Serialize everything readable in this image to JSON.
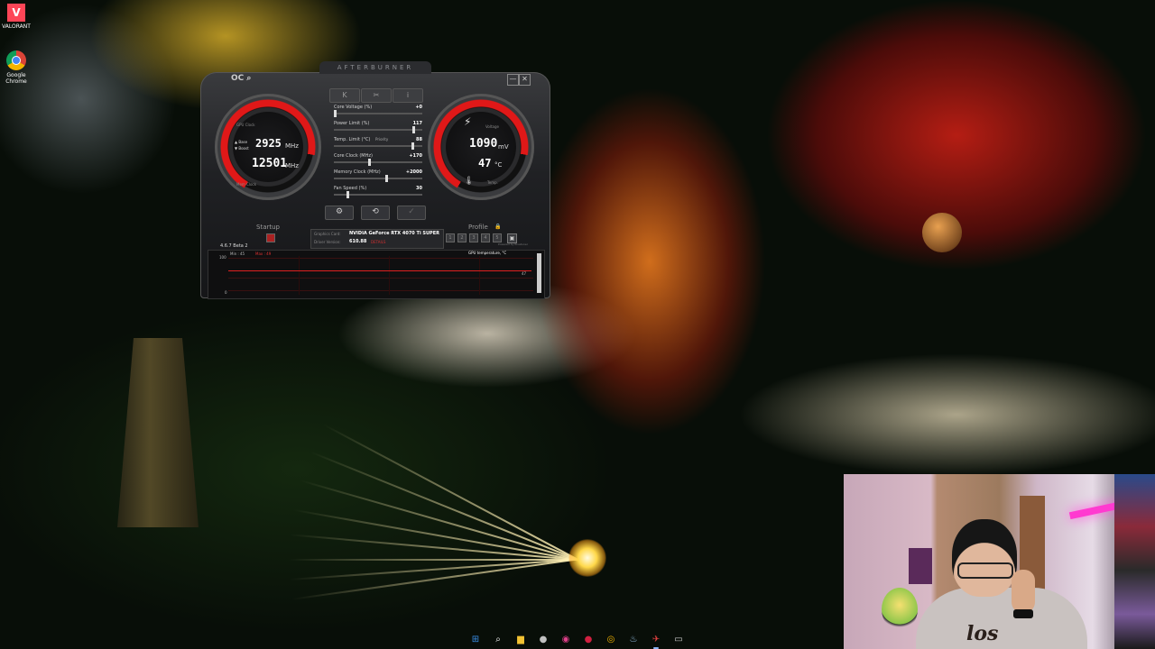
{
  "desktop": {
    "icons": [
      {
        "label": "VALORANT",
        "glyph": "V"
      },
      {
        "label": "Google Chrome"
      }
    ]
  },
  "afterburner": {
    "brand": "AFTERBURNER",
    "oc_label": "OC",
    "window_buttons": {
      "minimize": "—",
      "close": "✕"
    },
    "top_buttons": [
      "K",
      "✂",
      "i"
    ],
    "left_gauge": {
      "label_top": "GPU Clock",
      "label_bottom": "Mem Clock",
      "base_label": "▲ Base",
      "boost_label": "▼ Boost",
      "gpu_clock": "2925",
      "gpu_clock_unit": "MHz",
      "mem_clock": "12501",
      "mem_clock_unit": "MHz",
      "ticks": [
        "250",
        "500",
        "750",
        "1000",
        "1250",
        "1500",
        "1750",
        "2000",
        "2250",
        "2500",
        "3000",
        "3750",
        "4500",
        "5250"
      ]
    },
    "right_gauge": {
      "label_top": "Voltage",
      "label_bottom": "Temp.",
      "voltage": "1090",
      "voltage_unit": "mV",
      "temp": "47",
      "temp_unit": "°C",
      "ticks": [
        "0.75",
        "1",
        "1.25",
        "1.5",
        "1.75",
        "32°F",
        "50",
        "68",
        "86",
        "104",
        "122",
        "140",
        "158",
        "176",
        "194"
      ]
    },
    "sliders": [
      {
        "label": "Core Voltage (%)",
        "value": "+0",
        "fill": 0.0
      },
      {
        "label": "Power Limit (%)",
        "value": "117",
        "fill": 0.92
      },
      {
        "label": "Temp. Limit (°C)",
        "sub": "Priority",
        "value": "88",
        "fill": 0.9
      },
      {
        "label": "Core Clock (MHz)",
        "value": "+170",
        "fill": 0.4
      },
      {
        "label": "Memory Clock (MHz)",
        "value": "+2000",
        "fill": 0.6
      },
      {
        "label": "Fan Speed (%)",
        "value": "30",
        "fill": 0.15
      }
    ],
    "bottom_buttons": [
      "⚙",
      "⟲",
      "✓"
    ],
    "startup_label": "Startup",
    "profile_label": "Profile",
    "profile_lock": "🔒",
    "profile_slots": [
      "1",
      "2",
      "3",
      "4",
      "5"
    ],
    "graphics_card_label": "Graphics Card:",
    "graphics_card": "NVIDIA GeForce RTX 4070 Ti SUPER",
    "driver_label": "Driver Version:",
    "driver_version": "610.88",
    "details_label": "DETAILS",
    "version": "4.6.7 Beta 2",
    "powered_by": "Powered by Rivatuner",
    "monitor": {
      "min_label": "Min : 45",
      "max_label": "Max : 49",
      "title": "GPU temperature, °C",
      "y_max": "100",
      "y_min": "0",
      "current": "47"
    }
  },
  "taskbar": {
    "items": [
      {
        "name": "start",
        "glyph": "⊞",
        "color": "#3a8ee6"
      },
      {
        "name": "search",
        "glyph": "⌕",
        "color": "#ffffff"
      },
      {
        "name": "explorer",
        "glyph": "▆",
        "color": "#f2c233"
      },
      {
        "name": "app-circle",
        "glyph": "●",
        "color": "#c0c0c0"
      },
      {
        "name": "app-pink",
        "glyph": "◉",
        "color": "#e0408a"
      },
      {
        "name": "app-red",
        "glyph": "●",
        "color": "#d02040"
      },
      {
        "name": "chrome",
        "glyph": "◎",
        "color": "#f4b400"
      },
      {
        "name": "steam",
        "glyph": "♨",
        "color": "#9ec8f0"
      },
      {
        "name": "afterburner",
        "glyph": "✈",
        "color": "#e04040"
      },
      {
        "name": "terminal",
        "glyph": "▭",
        "color": "#cccccc"
      }
    ]
  },
  "webcam": {
    "shirt_text": "los"
  }
}
